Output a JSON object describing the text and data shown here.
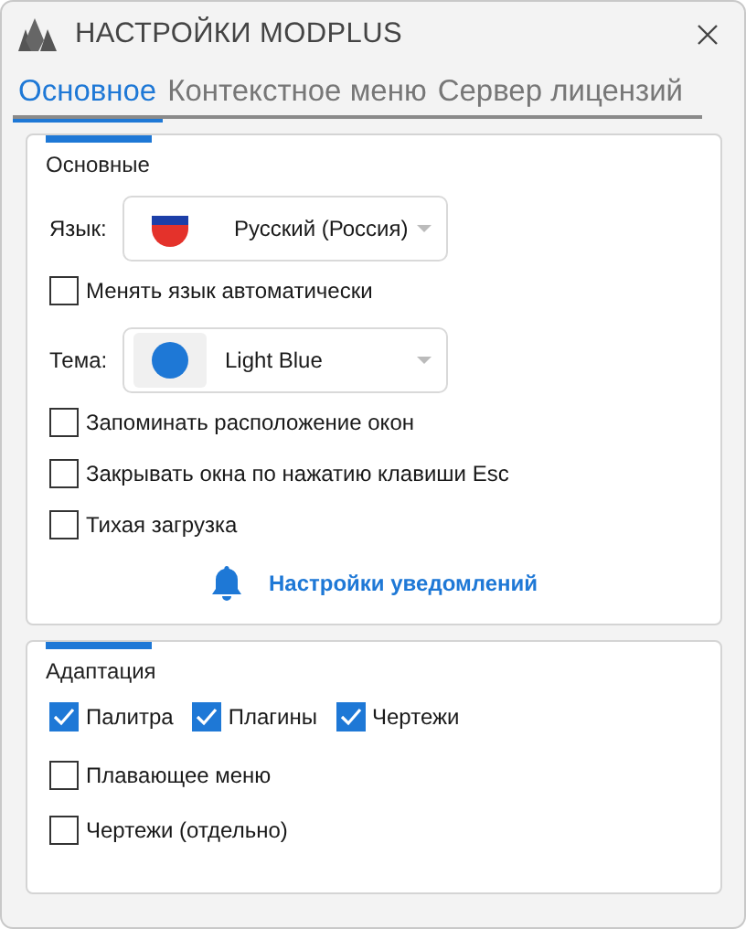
{
  "window": {
    "title": "НАСТРОЙКИ MODPLUS"
  },
  "tabs": [
    {
      "label": "Основное",
      "selected": true
    },
    {
      "label": "Контекстное меню",
      "selected": false
    },
    {
      "label": "Сервер лицензий",
      "selected": false
    }
  ],
  "sections": [
    {
      "title": "Основные",
      "items": [
        {
          "kind": "flag-combo",
          "label": "Язык:",
          "value": "Русский (Россия)"
        },
        {
          "kind": "checkbox",
          "label": "Менять язык автоматически",
          "checked": false
        },
        {
          "kind": "swatch-combo",
          "label": "Тема:",
          "value": "Light Blue"
        },
        {
          "kind": "checkbox",
          "label": "Запоминать расположение окон",
          "checked": false
        },
        {
          "kind": "checkbox",
          "label": "Закрывать окна по нажатию клавиши Esc",
          "checked": false
        },
        {
          "kind": "checkbox",
          "label": "Тихая загрузка",
          "checked": false
        },
        {
          "kind": "link",
          "label": "Настройки уведомлений"
        }
      ]
    },
    {
      "title": "Адаптация",
      "items": [
        {
          "kind": "check-row",
          "checks": [
            {
              "label": "Палитра",
              "checked": true
            },
            {
              "label": "Плагины",
              "checked": true
            },
            {
              "label": "Чертежи",
              "checked": true
            }
          ]
        },
        {
          "kind": "checkbox",
          "label": "Плавающее меню",
          "checked": false
        },
        {
          "kind": "checkbox",
          "label": "Чертежи (отдельно)",
          "checked": false
        }
      ]
    }
  ]
}
